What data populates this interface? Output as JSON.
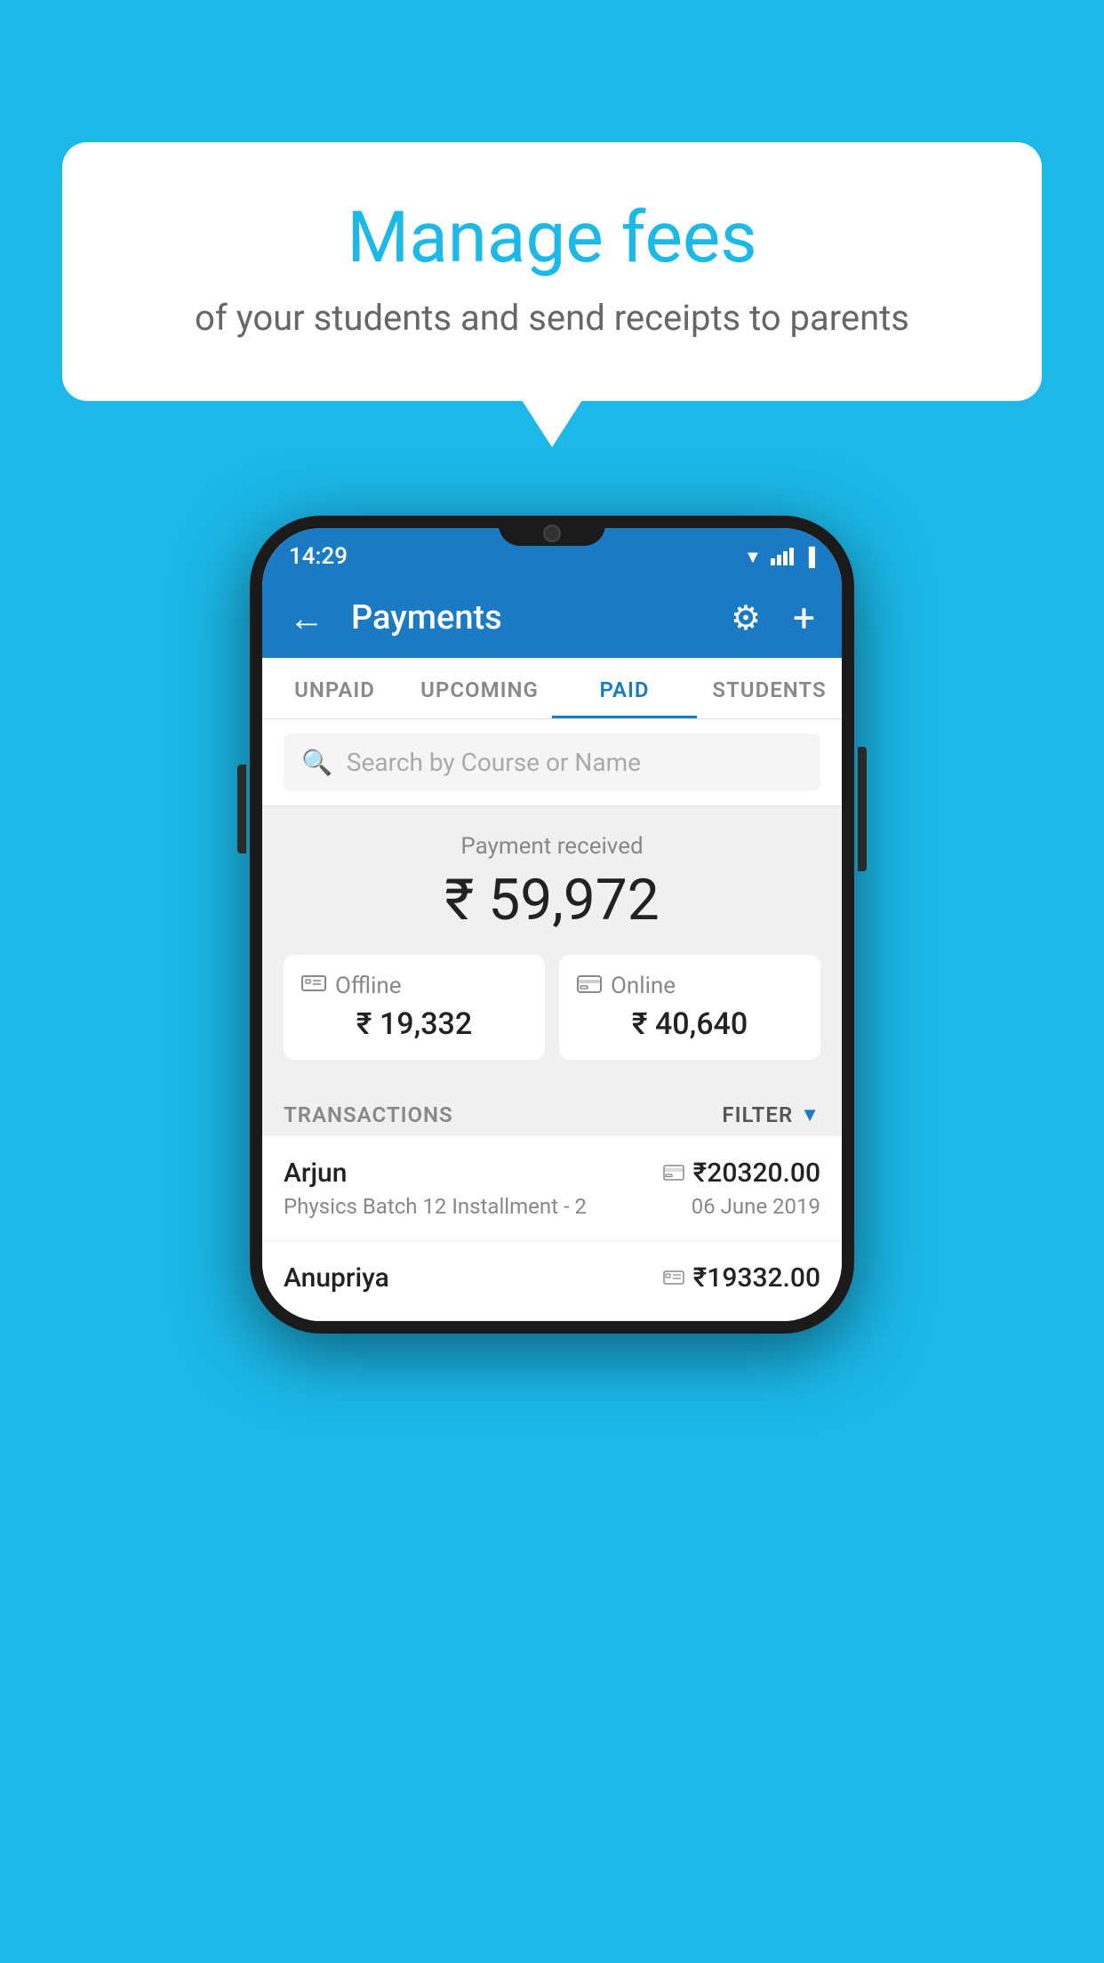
{
  "background_color": "#1bb8e8",
  "speech_bubble": {
    "title": "Manage fees",
    "subtitle": "of your students and send receipts to parents"
  },
  "status_bar": {
    "time": "14:29",
    "wifi": "▲",
    "battery": "🔋"
  },
  "header": {
    "title": "Payments",
    "back_label": "←",
    "gear_label": "⚙",
    "plus_label": "+"
  },
  "tabs": [
    {
      "label": "UNPAID",
      "active": false
    },
    {
      "label": "UPCOMING",
      "active": false
    },
    {
      "label": "PAID",
      "active": true
    },
    {
      "label": "STUDENTS",
      "active": false
    }
  ],
  "search": {
    "placeholder": "Search by Course or Name"
  },
  "payment_summary": {
    "label": "Payment received",
    "total": "₹ 59,972",
    "offline": {
      "icon": "💳",
      "label": "Offline",
      "amount": "₹ 19,332"
    },
    "online": {
      "icon": "💳",
      "label": "Online",
      "amount": "₹ 40,640"
    }
  },
  "transactions": {
    "label": "TRANSACTIONS",
    "filter_label": "FILTER",
    "items": [
      {
        "name": "Arjun",
        "amount": "₹20320.00",
        "course": "Physics Batch 12 Installment - 2",
        "date": "06 June 2019",
        "payment_type": "online"
      },
      {
        "name": "Anupriya",
        "amount": "₹19332.00",
        "course": "",
        "date": "",
        "payment_type": "offline"
      }
    ]
  }
}
